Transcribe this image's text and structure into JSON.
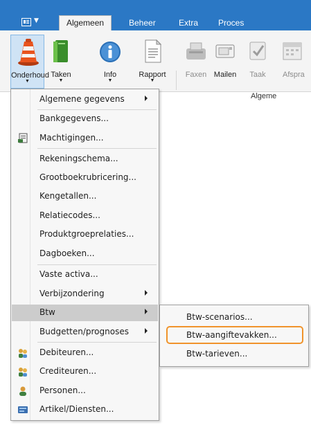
{
  "ribbon": {
    "tabs": [
      {
        "label": "Algemeen",
        "active": true
      },
      {
        "label": "Beheer",
        "active": false
      },
      {
        "label": "Extra",
        "active": false
      },
      {
        "label": "Proces",
        "active": false
      }
    ],
    "buttons": [
      {
        "label": "Onderhoud",
        "icon": "traffic-cone-icon",
        "has_dropdown": true,
        "selected": true
      },
      {
        "label": "Taken",
        "icon": "book-icon",
        "has_dropdown": true
      },
      {
        "label": "Info",
        "icon": "info-icon",
        "has_dropdown": true
      },
      {
        "label": "Rapport",
        "icon": "document-icon",
        "has_dropdown": true
      },
      {
        "label": "Faxen",
        "icon": "fax-icon",
        "disabled": true
      },
      {
        "label": "Mailen",
        "icon": "mail-icon",
        "disabled": false
      },
      {
        "label": "Taak",
        "icon": "checklist-icon",
        "disabled": true
      },
      {
        "label": "Afspra",
        "icon": "calendar-icon",
        "disabled": true
      }
    ],
    "group_label": "Algeme"
  },
  "menu": {
    "items": [
      {
        "label": "Algemene gegevens",
        "submenu": true
      },
      {
        "label": "Bankgegevens..."
      },
      {
        "label": "Machtigingen...",
        "icon": "authorization-icon"
      },
      {
        "label": "Rekeningschema..."
      },
      {
        "label": "Grootboekrubricering..."
      },
      {
        "label": "Kengetallen..."
      },
      {
        "label": "Relatiecodes..."
      },
      {
        "label": "Produktgroeprelaties..."
      },
      {
        "label": "Dagboeken..."
      },
      {
        "label": "Vaste activa..."
      },
      {
        "label": "Verbijzondering",
        "submenu": true
      },
      {
        "label": "Btw",
        "submenu": true,
        "highlighted": true
      },
      {
        "label": "Budgetten/prognoses",
        "submenu": true
      },
      {
        "label": "Debiteuren...",
        "icon": "debtors-icon"
      },
      {
        "label": "Crediteuren...",
        "icon": "creditors-icon"
      },
      {
        "label": "Personen...",
        "icon": "person-icon"
      },
      {
        "label": "Artikel/Diensten...",
        "icon": "articles-icon"
      }
    ]
  },
  "btw_submenu": {
    "items": [
      {
        "label": "Btw-scenarios..."
      },
      {
        "label": "Btw-aangiftevakken...",
        "focused": true
      },
      {
        "label": "Btw-tarieven..."
      }
    ]
  },
  "colors": {
    "tab_strip": "#2b78c5",
    "highlight": "#cccccc",
    "focus_ring": "#f0932b"
  }
}
